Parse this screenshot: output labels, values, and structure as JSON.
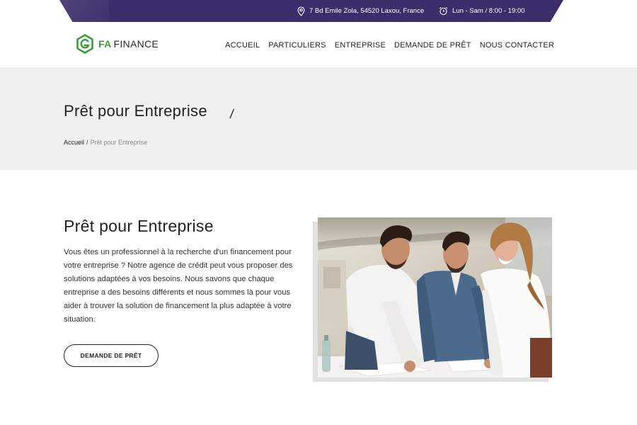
{
  "topbar": {
    "address": "7 Bd Emile Zola, 54520 Laxou, France",
    "hours": "Lun - Sam / 8:00 - 19:00"
  },
  "brand": {
    "accent": "FA",
    "name": "FINANCE",
    "green": "#3a9b3f",
    "purple": "#3d2d6b"
  },
  "nav": {
    "items": [
      "ACCUEIL",
      "PARTICULIERS",
      "ENTREPRISE",
      "DEMANDE DE PRÊT",
      "NOUS CONTACTER"
    ]
  },
  "hero": {
    "title": "Prêt pour Entreprise",
    "slash": "/",
    "breadcrumb_home": "Accueil",
    "breadcrumb_sep": "/",
    "breadcrumb_current": "Prêt pour Entreprise"
  },
  "content": {
    "title": "Prêt pour Entreprise",
    "text": "Vous êtes un professionnel à la recherche d'un financement pour votre entreprise ? Notre agence de crédit peut vous proposer des solutions adaptées à vos besoins. Nous savons que chaque entreprise a des besoins différents et nous sommes là pour vous aider à trouver la solution de financement la plus adaptée à votre situation.",
    "cta": "DEMANDE DE PRÊT"
  },
  "icons": {
    "address": "map-pin-icon",
    "hours": "alarm-clock-icon",
    "logo": "fa-finance-logo-icon"
  }
}
